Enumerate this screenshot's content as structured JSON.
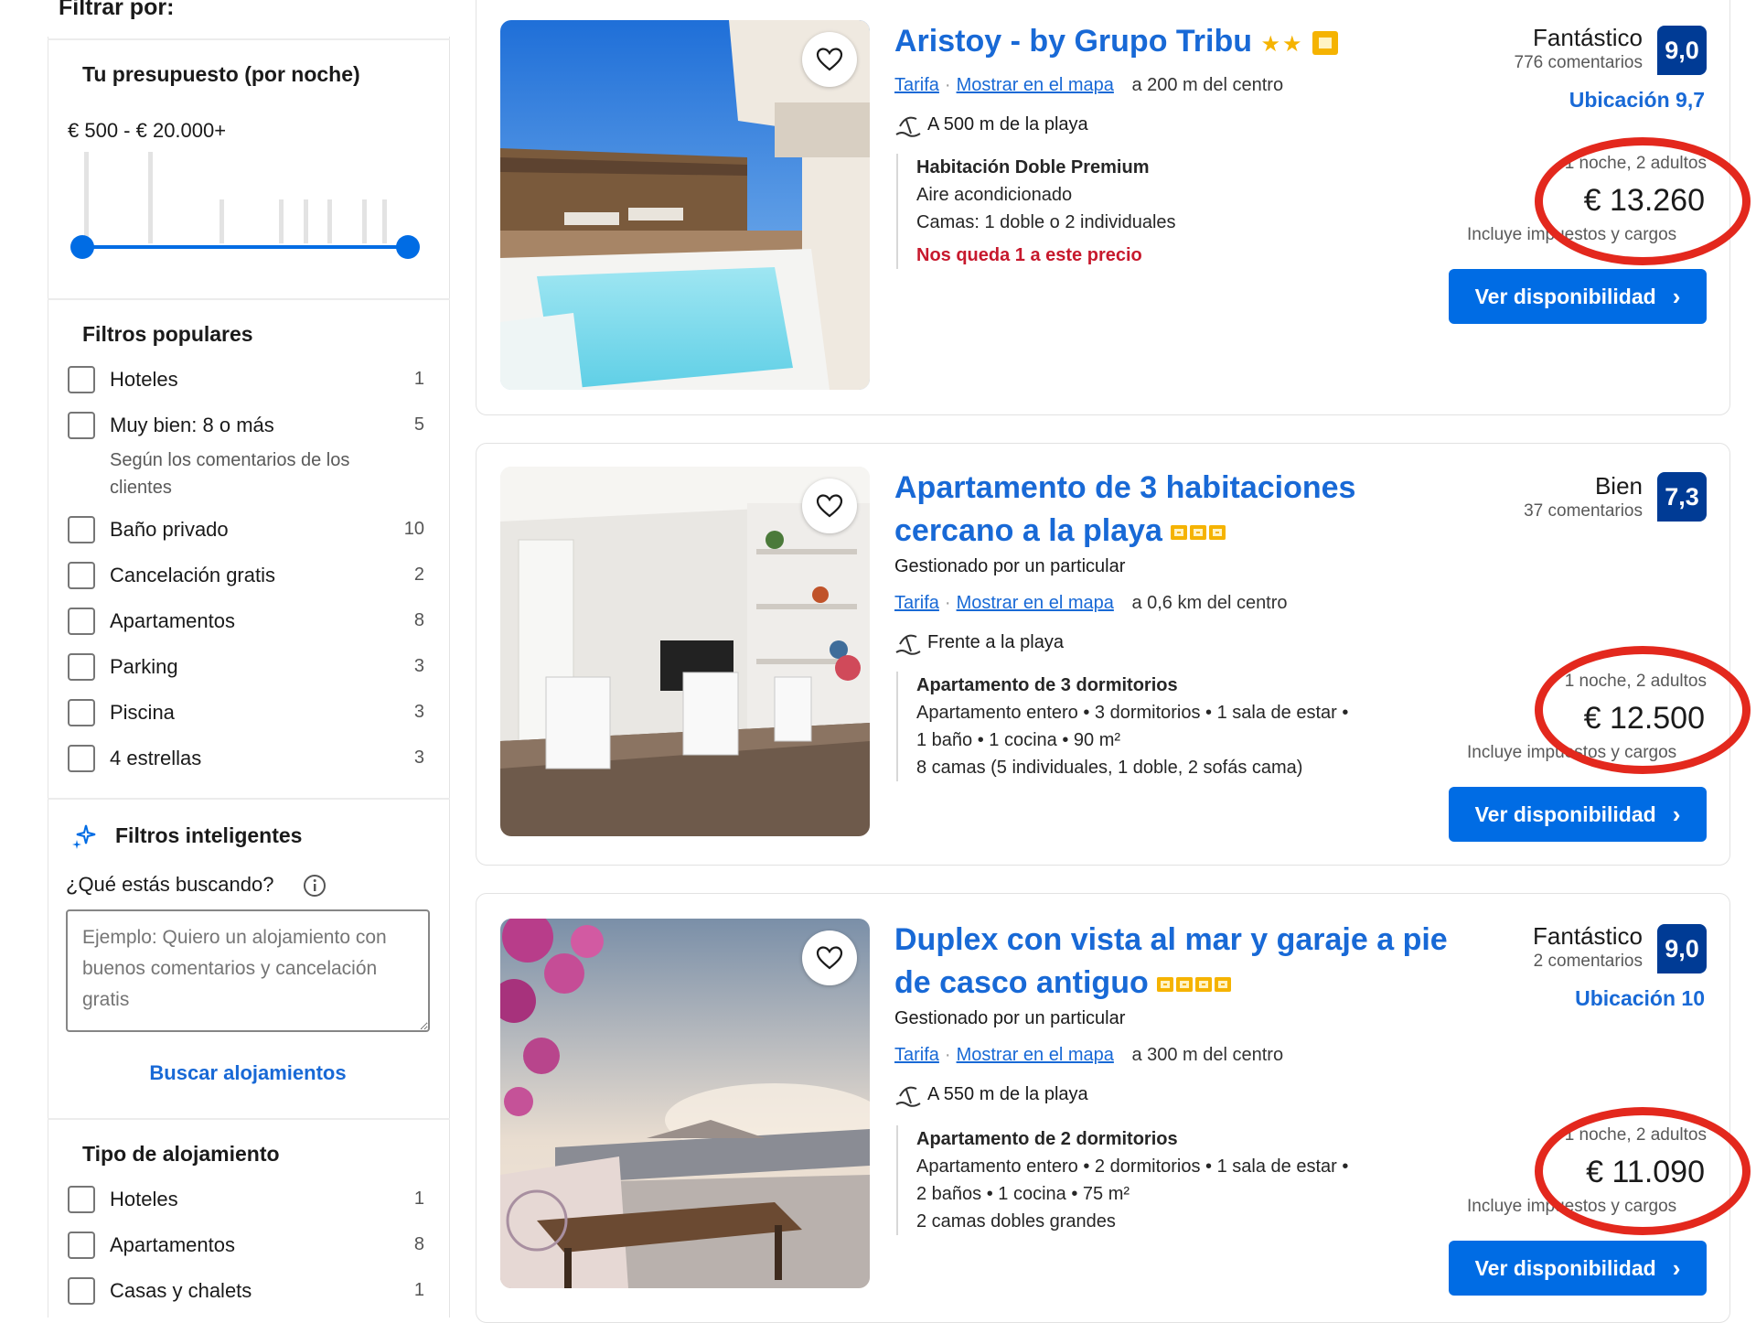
{
  "sidebar": {
    "filter_title": "Filtrar por:",
    "budget": {
      "heading": "Tu presupuesto (por noche)",
      "range": "€ 500 - € 20.000+",
      "min_fraction": 0.0,
      "max_fraction": 1.0
    },
    "popular": {
      "heading": "Filtros populares",
      "items": [
        {
          "label": "Hoteles",
          "count": "1"
        },
        {
          "label": "Muy bien: 8 o más",
          "count": "5",
          "sub": "Según los comentarios de los clientes"
        },
        {
          "label": "Baño privado",
          "count": "10"
        },
        {
          "label": "Cancelación gratis",
          "count": "2"
        },
        {
          "label": "Apartamentos",
          "count": "8"
        },
        {
          "label": "Parking",
          "count": "3"
        },
        {
          "label": "Piscina",
          "count": "3"
        },
        {
          "label": "4 estrellas",
          "count": "3"
        }
      ]
    },
    "smart": {
      "heading": "Filtros inteligentes",
      "question": "¿Qué estás buscando?",
      "placeholder": "Ejemplo: Quiero un alojamiento con buenos comentarios y cancelación gratis",
      "search_link": "Buscar alojamientos"
    },
    "type": {
      "heading": "Tipo de alojamiento",
      "items": [
        {
          "label": "Hoteles",
          "count": "1"
        },
        {
          "label": "Apartamentos",
          "count": "8"
        },
        {
          "label": "Casas y chalets",
          "count": "1"
        }
      ]
    }
  },
  "listings": [
    {
      "title": "Aristoy - by Grupo Tribu",
      "city": "Tarifa",
      "map": "Mostrar en el mapa",
      "distance": "a 200 m del centro",
      "beach": "A 500 m de la playa",
      "unit_title": "Habitación Doble Premium",
      "unit_lines": [
        "Aire acondicionado",
        "Camas: 1 doble o 2 individuales"
      ],
      "warning": "Nos queda 1 a este precio",
      "score_word": "Fantástico",
      "reviews": "776 comentarios",
      "score": "9,0",
      "location": "Ubicación 9,7",
      "night": "1 noche, 2 adultos",
      "price": "€ 13.260",
      "taxes": "Incluye impuestos y cargos",
      "cta": "Ver disponibilidad"
    },
    {
      "title": "Apartamento de 3 habitaciones cercano a la playa",
      "managed": "Gestionado por un particular",
      "city": "Tarifa",
      "map": "Mostrar en el mapa",
      "distance": "a 0,6 km del centro",
      "beach": "Frente a la playa",
      "unit_title": "Apartamento de 3 dormitorios",
      "unit_lines": [
        "Apartamento entero • 3 dormitorios • 1 sala de estar •",
        "1 baño • 1 cocina • 90 m²",
        "8 camas (5 individuales, 1 doble, 2 sofás cama)"
      ],
      "score_word": "Bien",
      "reviews": "37 comentarios",
      "score": "7,3",
      "night": "1 noche, 2 adultos",
      "price": "€ 12.500",
      "taxes": "Incluye impuestos y cargos",
      "cta": "Ver disponibilidad"
    },
    {
      "title": "Duplex con vista al mar y garaje a pie de casco antiguo",
      "managed": "Gestionado por un particular",
      "city": "Tarifa",
      "map": "Mostrar en el mapa",
      "distance": "a 300 m del centro",
      "beach": "A 550 m de la playa",
      "unit_title": "Apartamento de 2 dormitorios",
      "unit_lines": [
        "Apartamento entero • 2 dormitorios • 1 sala de estar •",
        "2 baños • 1 cocina • 75 m²",
        "2 camas dobles grandes"
      ],
      "score_word": "Fantástico",
      "reviews": "2 comentarios",
      "score": "9,0",
      "location": "Ubicación 10",
      "night": "1 noche, 2 adultos",
      "price": "€ 11.090",
      "taxes": "Incluye impuestos y cargos",
      "cta": "Ver disponibilidad"
    }
  ],
  "colors": {
    "link": "#1869d6",
    "score_bg": "#003b95",
    "button": "#006ce4",
    "warning": "#c7192d",
    "star": "#f5b301",
    "annotation": "#e3281d"
  }
}
